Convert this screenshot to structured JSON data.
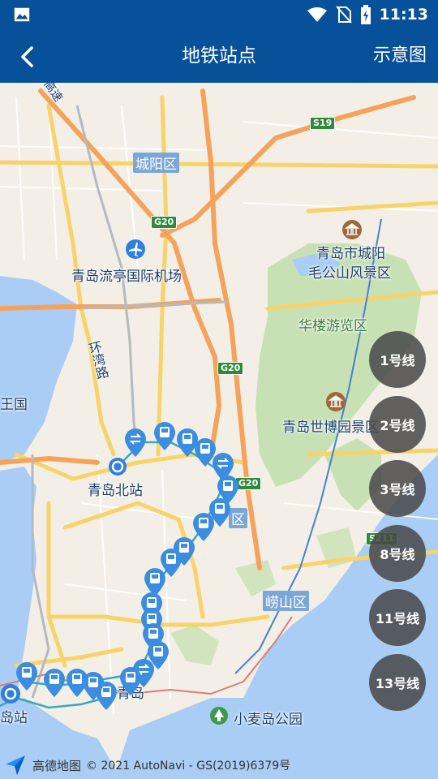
{
  "status_bar": {
    "time": "11:13",
    "icons": [
      "image-icon",
      "wifi-icon",
      "no-sim-icon",
      "battery-charging-icon"
    ]
  },
  "app_bar": {
    "back_icon": "chevron-left-icon",
    "title": "地铁站点",
    "diagram_label": "示意图",
    "background_color": "#06519a"
  },
  "map": {
    "labels": {
      "gaosu": "高速",
      "s19": "S19",
      "chengyang": "城阳区",
      "g20_top": "G20",
      "g20_mid": "G20",
      "g20_low": "G20",
      "s211": "S211",
      "airport": "青岛流亭国际机场",
      "maoshan": "青岛市城阳",
      "maoshan2": "毛公山风景区",
      "hualou": "华楼游览区",
      "huanwan": "环湾路",
      "region_left": "王国",
      "shibo": "青岛世博园景区",
      "north_station": "青岛北站",
      "district_mid": "区",
      "laoshan": "崂山区",
      "qingdao": "青岛",
      "station_left": "岛站",
      "xiaomaidao": "小麦岛公园"
    },
    "colors": {
      "land": "#f3efe6",
      "water": "#a9cdf4",
      "green": "#c8e1b4",
      "highway": "#f5a25b",
      "major_road": "#f8d36a",
      "marker": "#3a8de0"
    }
  },
  "line_buttons": [
    "1号线",
    "2号线",
    "3号线",
    "8号线",
    "11号线",
    "13号线"
  ],
  "footer": {
    "logo_text": "高德地图",
    "copyright": "© 2021 AutoNavi - GS(2019)6379号"
  }
}
